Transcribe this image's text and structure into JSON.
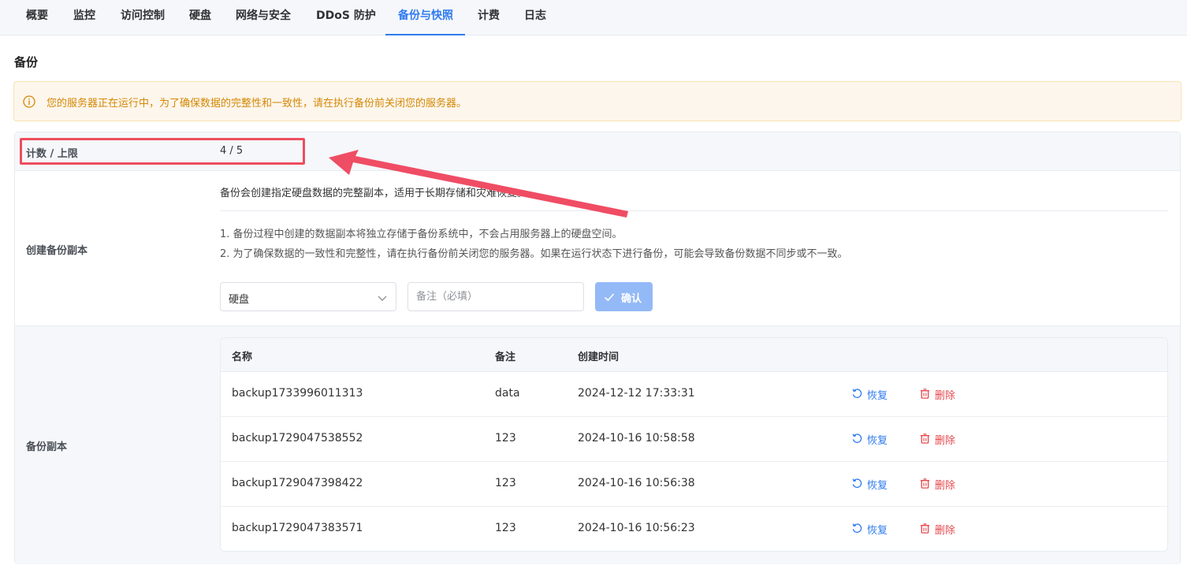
{
  "tabs": [
    {
      "label": "概要"
    },
    {
      "label": "监控"
    },
    {
      "label": "访问控制"
    },
    {
      "label": "硬盘"
    },
    {
      "label": "网络与安全"
    },
    {
      "label": "DDoS 防护"
    },
    {
      "label": "备份与快照"
    },
    {
      "label": "计费"
    },
    {
      "label": "日志"
    }
  ],
  "active_tab": "备份与快照",
  "section_title": "备份",
  "alert": {
    "text": "您的服务器正在运行中，为了确保数据的完整性和一致性，请在执行备份前关闭您的服务器。",
    "icon": "info-circle-icon",
    "color": "#d48806"
  },
  "count": {
    "label": "计数 / 上限",
    "value": "4 / 5"
  },
  "create": {
    "label": "创建备份副本",
    "description": "备份会创建指定硬盘数据的完整副本，适用于长期存储和灾难恢复。",
    "notes": [
      "1. 备份过程中创建的数据副本将独立存储于备份系统中，不会占用服务器上的硬盘空间。",
      "2. 为了确保数据的一致性和完整性，请在执行备份前关闭您的服务器。如果在运行状态下进行备份，可能会导致备份数据不同步或不一致。"
    ],
    "disk_select_value": "硬盘",
    "remark_placeholder": "备注（必填）",
    "confirm_label": "确认"
  },
  "backups": {
    "label": "备份副本",
    "columns": [
      "名称",
      "备注",
      "创建时间"
    ],
    "rows": [
      {
        "name": "backup1733996011313",
        "remark": "data",
        "created": "2024-12-12 17:33:31"
      },
      {
        "name": "backup1729047538552",
        "remark": "123",
        "created": "2024-10-16 10:58:58"
      },
      {
        "name": "backup1729047398422",
        "remark": "123",
        "created": "2024-10-16 10:56:38"
      },
      {
        "name": "backup1729047383571",
        "remark": "123",
        "created": "2024-10-16 10:56:23"
      }
    ],
    "restore_label": "恢复",
    "delete_label": "删除"
  },
  "colors": {
    "accent": "#2f7bef",
    "danger": "#e5484d",
    "annotation": "#ee4d5f"
  }
}
